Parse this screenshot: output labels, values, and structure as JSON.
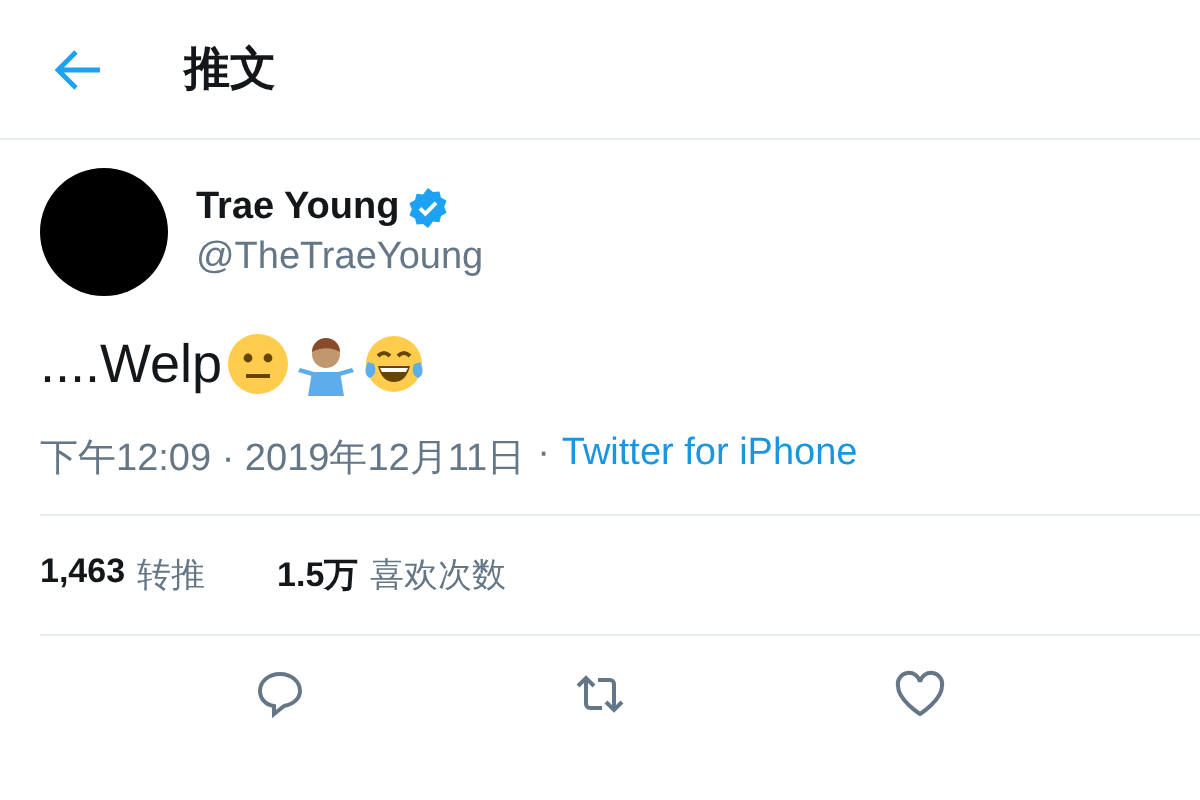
{
  "header": {
    "title": "推文"
  },
  "tweet": {
    "name": "Trae Young",
    "verified": true,
    "handle": "@TheTraeYoung",
    "text": "....Welp",
    "timestamp": "下午12:09 · 2019年12月11日",
    "separator": "·",
    "source": "Twitter for iPhone"
  },
  "stats": [
    {
      "count": "1,463",
      "label": "转推"
    },
    {
      "count": "1.5万",
      "label": "喜欢次数"
    }
  ]
}
